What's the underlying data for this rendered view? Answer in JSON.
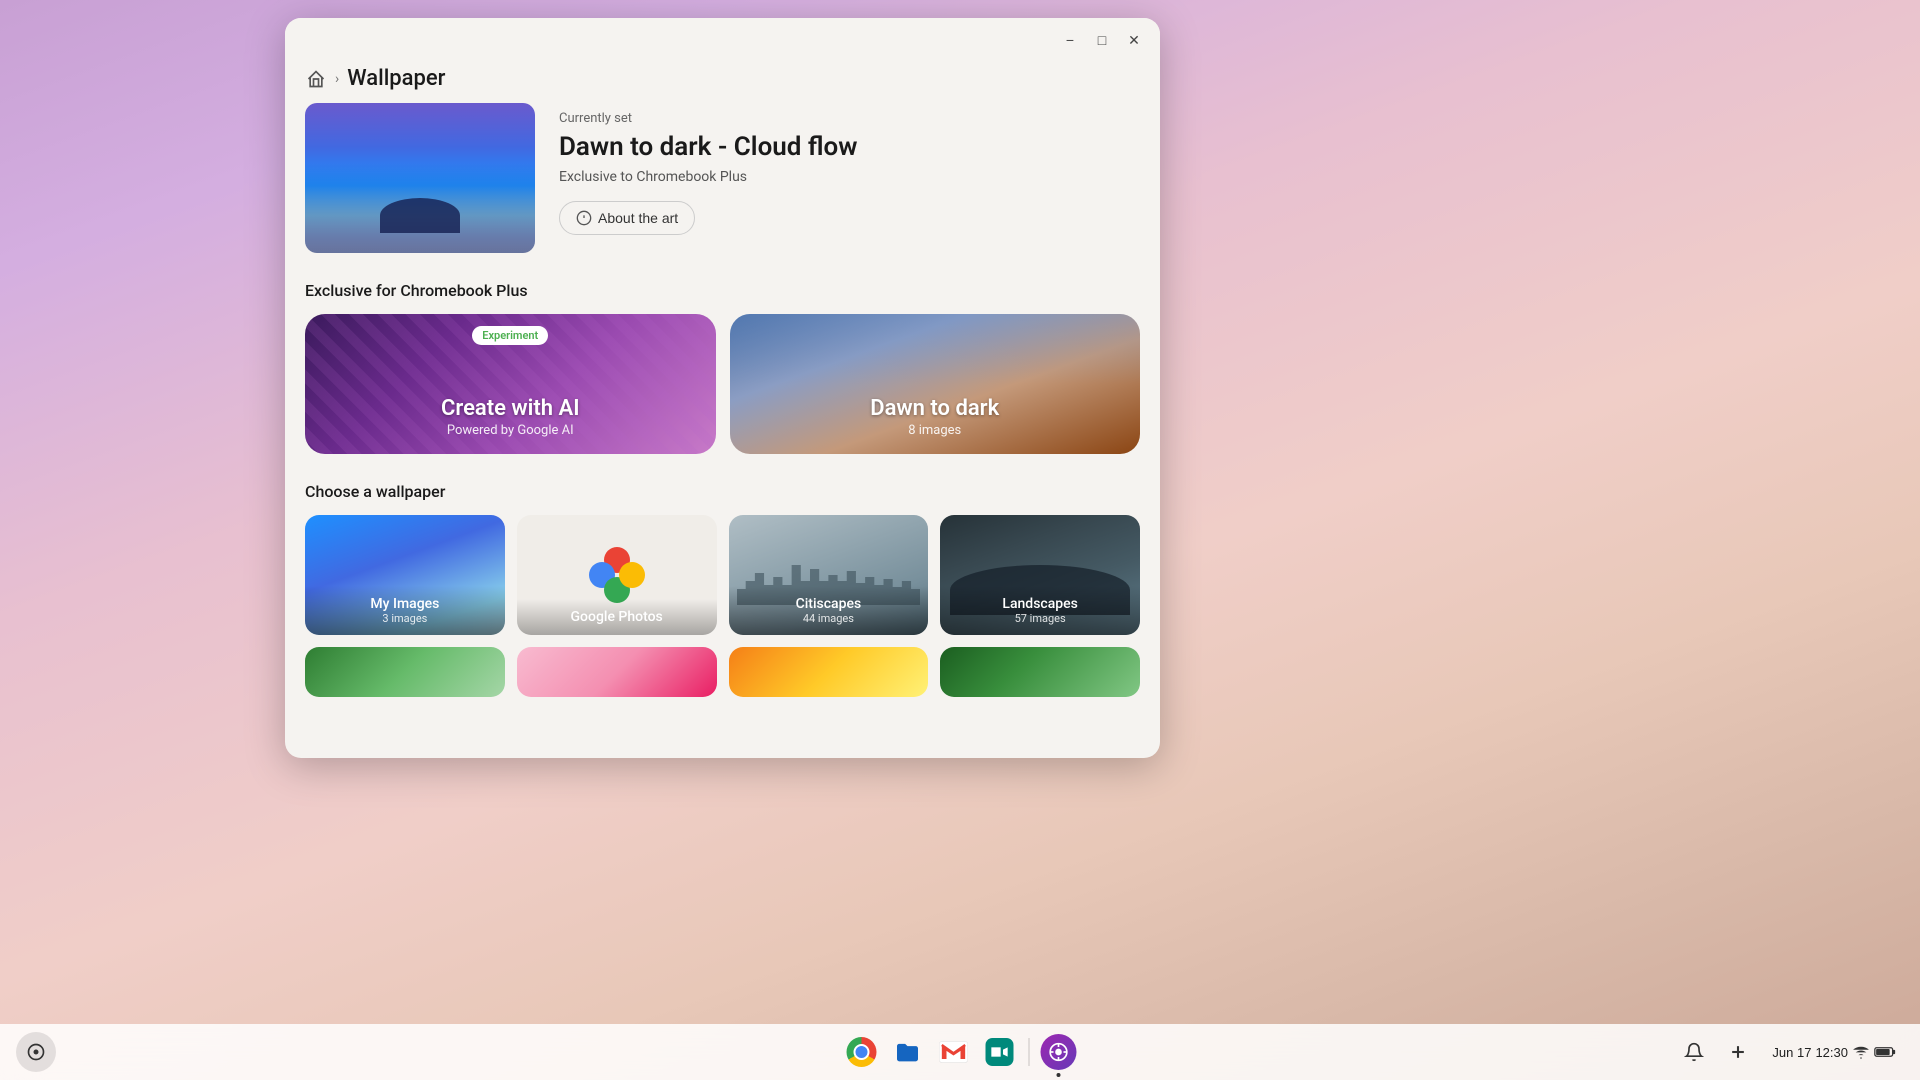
{
  "desktop": {
    "background": "lavender-pink gradient"
  },
  "window": {
    "title": "Wallpaper",
    "breadcrumb": {
      "home_label": "Home",
      "separator": ">",
      "current": "Wallpaper"
    },
    "controls": {
      "minimize": "−",
      "maximize": "□",
      "close": "✕"
    },
    "current_wallpaper": {
      "label": "Currently set",
      "name": "Dawn to dark - Cloud flow",
      "exclusive": "Exclusive to Chromebook Plus",
      "about_btn": "About the art"
    },
    "sections": {
      "chromebook_plus": {
        "title": "Exclusive for Chromebook Plus",
        "cards": [
          {
            "badge": "Experiment",
            "main": "Create with AI",
            "sub": "Powered by Google AI"
          },
          {
            "main": "Dawn to dark",
            "sub": "8 images"
          }
        ]
      },
      "choose": {
        "title": "Choose a wallpaper",
        "categories": [
          {
            "name": "My Images",
            "count": "3 images"
          },
          {
            "name": "Google Photos",
            "count": ""
          },
          {
            "name": "Citiscapes",
            "count": "44 images"
          },
          {
            "name": "Landscapes",
            "count": "57 images"
          }
        ]
      }
    }
  },
  "taskbar": {
    "launcher_icon": "⊙",
    "apps": [
      {
        "name": "Chrome",
        "type": "chrome"
      },
      {
        "name": "Files",
        "type": "files"
      },
      {
        "name": "Gmail",
        "type": "gmail"
      },
      {
        "name": "Meet",
        "type": "meet"
      },
      {
        "name": "Wallpaper & Style",
        "type": "wallpaper",
        "active": true
      }
    ],
    "tray": {
      "date": "Jun 17",
      "time": "12:30",
      "notif_icon": "🔔",
      "add_icon": "+"
    }
  }
}
